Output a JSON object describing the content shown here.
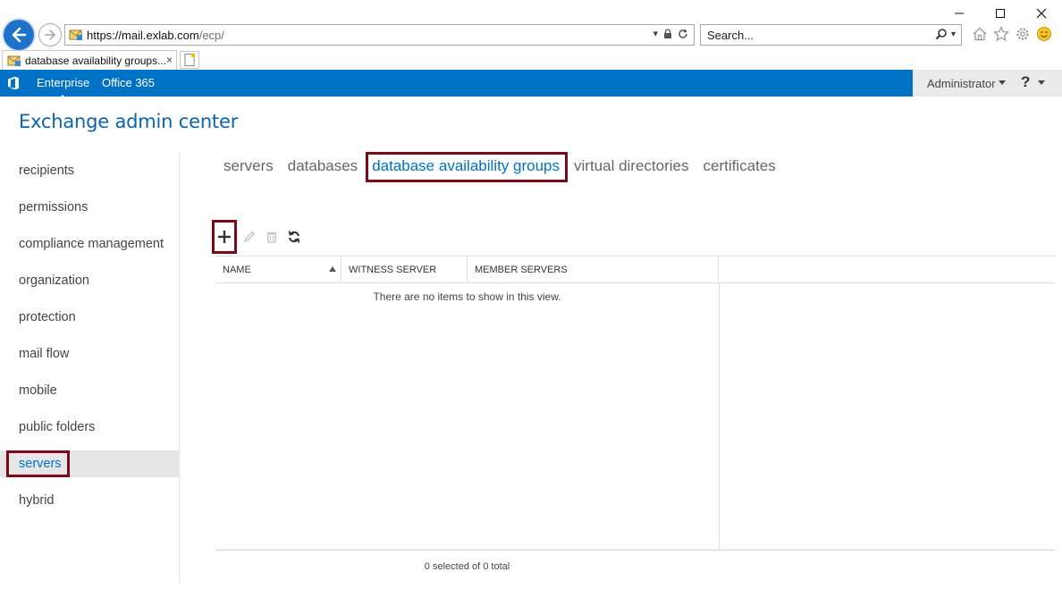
{
  "browser": {
    "url_host": "https://mail.exlab.com",
    "url_path": "/ecp/",
    "search_placeholder": "Search...",
    "tab_title": "database availability groups...",
    "tab_close": "×"
  },
  "topbar": {
    "enterprise": "Enterprise",
    "office365": "Office 365",
    "user": "Administrator",
    "help": "?"
  },
  "page": {
    "title": "Exchange admin center"
  },
  "leftnav": {
    "items": [
      {
        "label": "recipients"
      },
      {
        "label": "permissions"
      },
      {
        "label": "compliance management"
      },
      {
        "label": "organization"
      },
      {
        "label": "protection"
      },
      {
        "label": "mail flow"
      },
      {
        "label": "mobile"
      },
      {
        "label": "public folders"
      },
      {
        "label": "servers"
      },
      {
        "label": "hybrid"
      }
    ],
    "selected": "servers"
  },
  "subtabs": {
    "items": [
      {
        "label": "servers"
      },
      {
        "label": "databases"
      },
      {
        "label": "database availability groups"
      },
      {
        "label": "virtual directories"
      },
      {
        "label": "certificates"
      }
    ],
    "active": "database availability groups"
  },
  "grid": {
    "columns": [
      "NAME",
      "WITNESS SERVER",
      "MEMBER SERVERS"
    ],
    "empty_message": "There are no items to show in this view.",
    "footer": "0 selected of 0 total"
  },
  "colors": {
    "accent": "#0072c6",
    "highlight_box": "#7a0a17",
    "title": "#0a64ad"
  }
}
